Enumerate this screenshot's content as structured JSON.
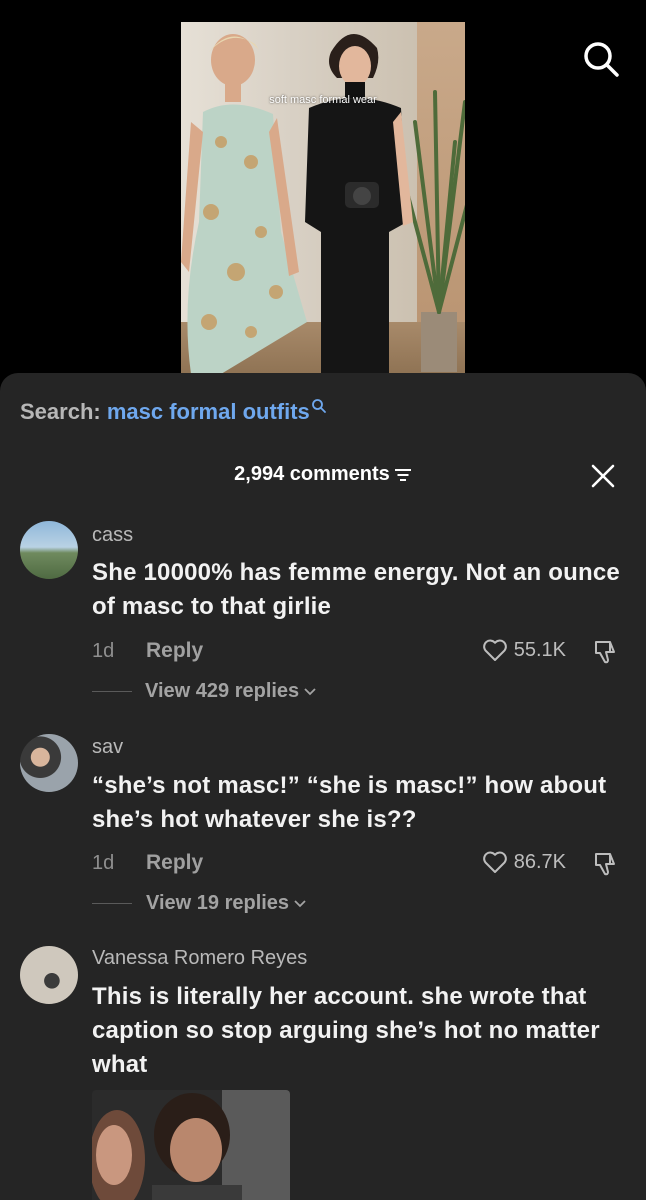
{
  "video": {
    "caption": "soft masc formal wear"
  },
  "search": {
    "prefix": "Search:",
    "query": "masc formal outfits"
  },
  "comments_header": {
    "count_label": "2,994 comments"
  },
  "comments": [
    {
      "username": "cass",
      "text": "She 10000% has femme energy. Not an ounce of masc to that girlie",
      "time": "1d",
      "reply_label": "Reply",
      "likes": "55.1K",
      "view_replies": "View 429 replies"
    },
    {
      "username": "sav",
      "text": "“she’s not masc!” “she is masc!” how about she’s hot whatever she is??",
      "time": "1d",
      "reply_label": "Reply",
      "likes": "86.7K",
      "view_replies": "View 19 replies"
    },
    {
      "username": "Vanessa Romero Reyes",
      "text": "This is literally her account. she wrote that caption so stop arguing she’s hot no matter what"
    }
  ],
  "colors": {
    "sheet_bg": "#252525",
    "search_query": "#6fa8ee",
    "muted_text": "#b9b9b9"
  },
  "icons": [
    "search-icon",
    "close-icon",
    "filter-icon",
    "heart-icon",
    "dislike-icon",
    "chevron-down-icon"
  ]
}
